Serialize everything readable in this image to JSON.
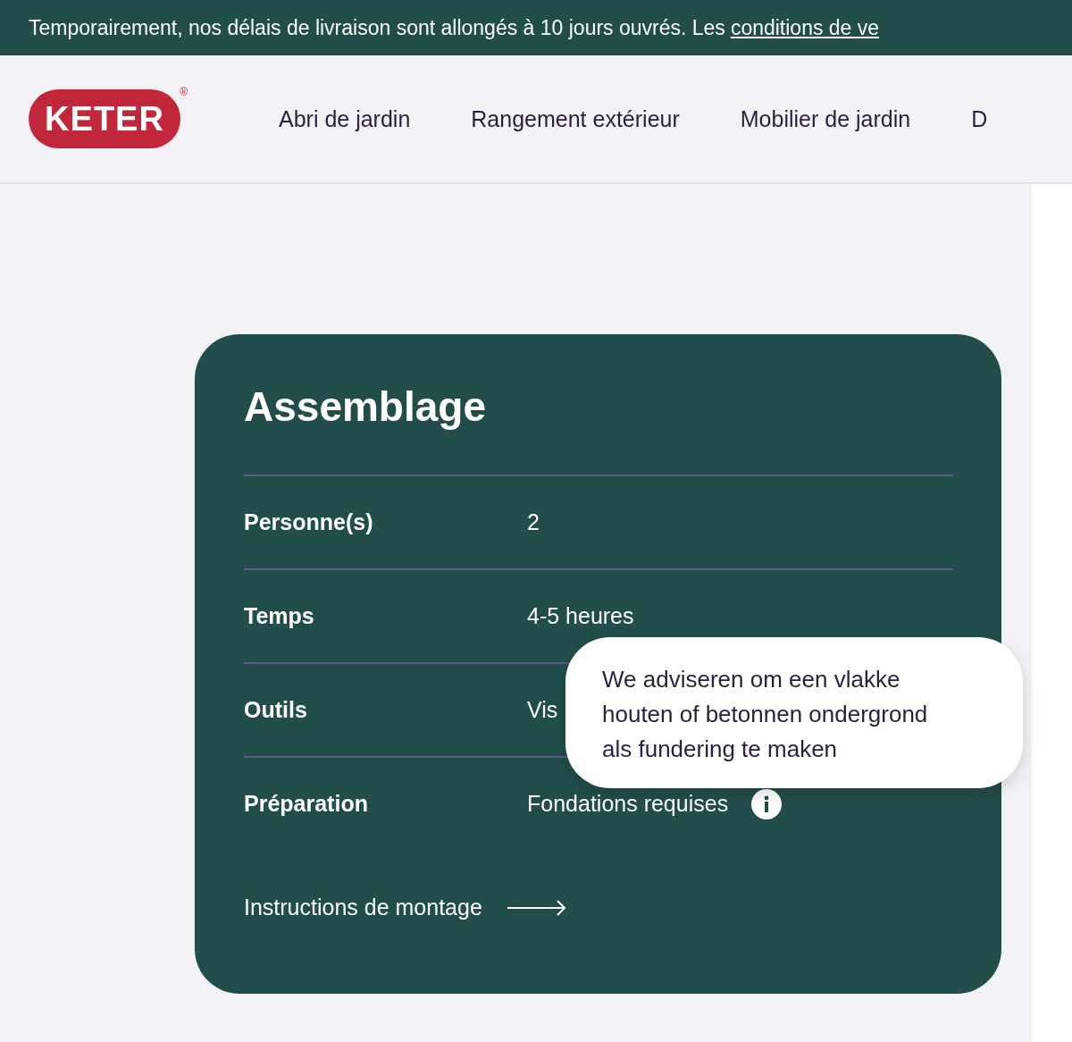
{
  "banner": {
    "text": "Temporairement, nos délais de livraison sont allongés à 10 jours ouvrés. Les",
    "link": "conditions de ve"
  },
  "header": {
    "logo": "KETER",
    "logo_mark": "®",
    "nav": [
      "Abri de jardin",
      "Rangement extérieur",
      "Mobilier de jardin",
      "D"
    ]
  },
  "card": {
    "title": "Assemblage",
    "rows": [
      {
        "label": "Personne(s)",
        "value": "2",
        "info": false
      },
      {
        "label": "Temps",
        "value": "4-5 heures",
        "info": false
      },
      {
        "label": "Outils",
        "value": "Vis",
        "info": false
      },
      {
        "label": "Préparation",
        "value": "Fondations requises",
        "info": true
      }
    ],
    "link": "Instructions de montage",
    "tooltip": "We adviseren om een vlakke houten of betonnen ondergrond als fundering te maken"
  }
}
